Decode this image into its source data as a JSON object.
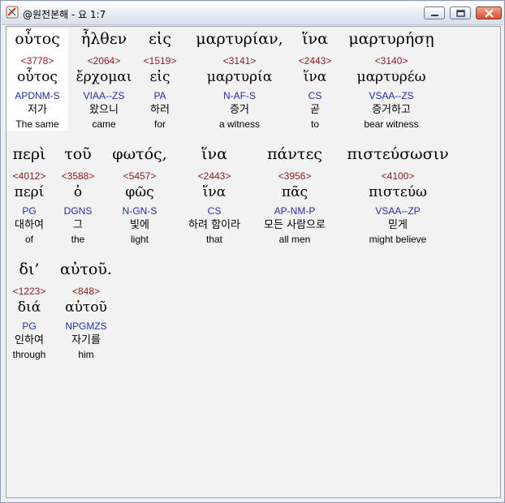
{
  "window": {
    "title": "@원전본해 - 요 1:7",
    "buttons": [
      "minimize",
      "maximize",
      "close"
    ]
  },
  "colors": {
    "strong": "#8b1a1a",
    "parse": "#1f2fa6",
    "title_bar": "#e6ebf3",
    "close_button": "#d4512f"
  },
  "interlinear": [
    {
      "word": "οὗτος",
      "strong": "<3778>",
      "lemma": "οὗτος",
      "parse": "APDNM-S",
      "korean": "저가",
      "english": "The same"
    },
    {
      "word": "ἦλθεν",
      "strong": "<2064>",
      "lemma": "ἔρχομαι",
      "parse": "VIAA--ZS",
      "korean": "왔으니",
      "english": "came"
    },
    {
      "word": "εἰς",
      "strong": "<1519>",
      "lemma": "εἰς",
      "parse": "PA",
      "korean": "하러",
      "english": "for"
    },
    {
      "word": "μαρτυρίαν,",
      "strong": "<3141>",
      "lemma": "μαρτυρία",
      "parse": "N-AF-S",
      "korean": "증거",
      "english": "a witness"
    },
    {
      "word": "ἵνα",
      "strong": "<2443>",
      "lemma": "ἵνα",
      "parse": "CS",
      "korean": "곧",
      "english": "to"
    },
    {
      "word": "μαρτυρήσῃ",
      "strong": "<3140>",
      "lemma": "μαρτυρέω",
      "parse": "VSAA--ZS",
      "korean": "증거하고",
      "english": "bear witness"
    },
    {
      "word": "περὶ",
      "strong": "<4012>",
      "lemma": "περί",
      "parse": "PG",
      "korean": "대하여",
      "english": "of"
    },
    {
      "word": "τοῦ",
      "strong": "<3588>",
      "lemma": "ὁ",
      "parse": "DGNS",
      "korean": "그",
      "english": "the"
    },
    {
      "word": "φωτός,",
      "strong": "<5457>",
      "lemma": "φῶς",
      "parse": "N-GN-S",
      "korean": "빛에",
      "english": "light"
    },
    {
      "word": "ἵνα",
      "strong": "<2443>",
      "lemma": "ἵνα",
      "parse": "CS",
      "korean": "하려 함이라",
      "english": "that"
    },
    {
      "word": "πάντες",
      "strong": "<3956>",
      "lemma": "πᾶς",
      "parse": "AP-NM-P",
      "korean": "모든 사람으로",
      "english": "all men"
    },
    {
      "word": "πιστεύσωσιν",
      "strong": "<4100>",
      "lemma": "πιστεύω",
      "parse": "VSAA--ZP",
      "korean": "믿게",
      "english": "might believe"
    },
    {
      "word": "δι’",
      "strong": "<1223>",
      "lemma": "διά",
      "parse": "PG",
      "korean": "인하여",
      "english": "through"
    },
    {
      "word": "αὐτοῦ.",
      "strong": "<848>",
      "lemma": "αὑτοῦ",
      "parse": "NPGMZS",
      "korean": "자기를",
      "english": "him"
    }
  ]
}
